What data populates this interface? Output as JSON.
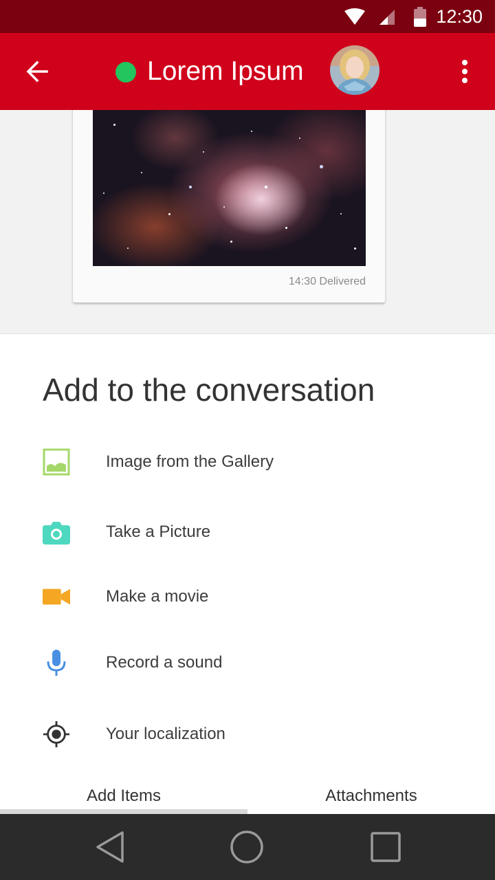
{
  "status_bar": {
    "time": "12:30"
  },
  "header": {
    "contact_name": "Lorem Ipsum",
    "presence_color": "#22c55e",
    "bar_color": "#d0021b"
  },
  "message": {
    "meta": "14:30 Delivered"
  },
  "sheet": {
    "title": "Add to the conversation",
    "options": [
      {
        "label": "Image from the Gallery",
        "icon": "gallery-icon",
        "color": "#a5d86a"
      },
      {
        "label": "Take a Picture",
        "icon": "camera-icon",
        "color": "#4fd8c0"
      },
      {
        "label": "Make a movie",
        "icon": "video-icon",
        "color": "#f5a623"
      },
      {
        "label": "Record a sound",
        "icon": "microphone-icon",
        "color": "#4a90e2"
      },
      {
        "label": "Your localization",
        "icon": "location-target-icon",
        "color": "#333333"
      }
    ]
  },
  "tabs": [
    {
      "label": "Add Items",
      "selected": true
    },
    {
      "label": "Attachments",
      "selected": false
    }
  ]
}
